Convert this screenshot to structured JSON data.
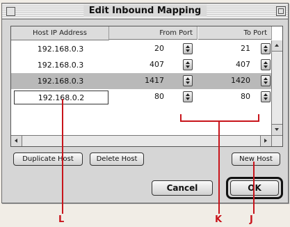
{
  "dialog": {
    "title": "Edit Inbound Mapping"
  },
  "table": {
    "headers": {
      "host": "Host IP Address",
      "from_port": "From Port",
      "to_port": "To Port"
    },
    "rows": [
      {
        "host": "192.168.0.3",
        "from_port": "20",
        "to_port": "21",
        "selected": false,
        "editing": false
      },
      {
        "host": "192.168.0.3",
        "from_port": "407",
        "to_port": "407",
        "selected": false,
        "editing": false
      },
      {
        "host": "192.168.0.3",
        "from_port": "1417",
        "to_port": "1420",
        "selected": true,
        "editing": false
      },
      {
        "host": "192.168.0.2",
        "from_port": "80",
        "to_port": "80",
        "selected": false,
        "editing": true
      }
    ]
  },
  "buttons": {
    "duplicate_host": "Duplicate Host",
    "delete_host": "Delete Host",
    "new_host": "New Host",
    "cancel": "Cancel",
    "ok": "OK"
  },
  "callouts": {
    "l": "L",
    "k": "K",
    "j": "J",
    "color": "#c8141b"
  }
}
